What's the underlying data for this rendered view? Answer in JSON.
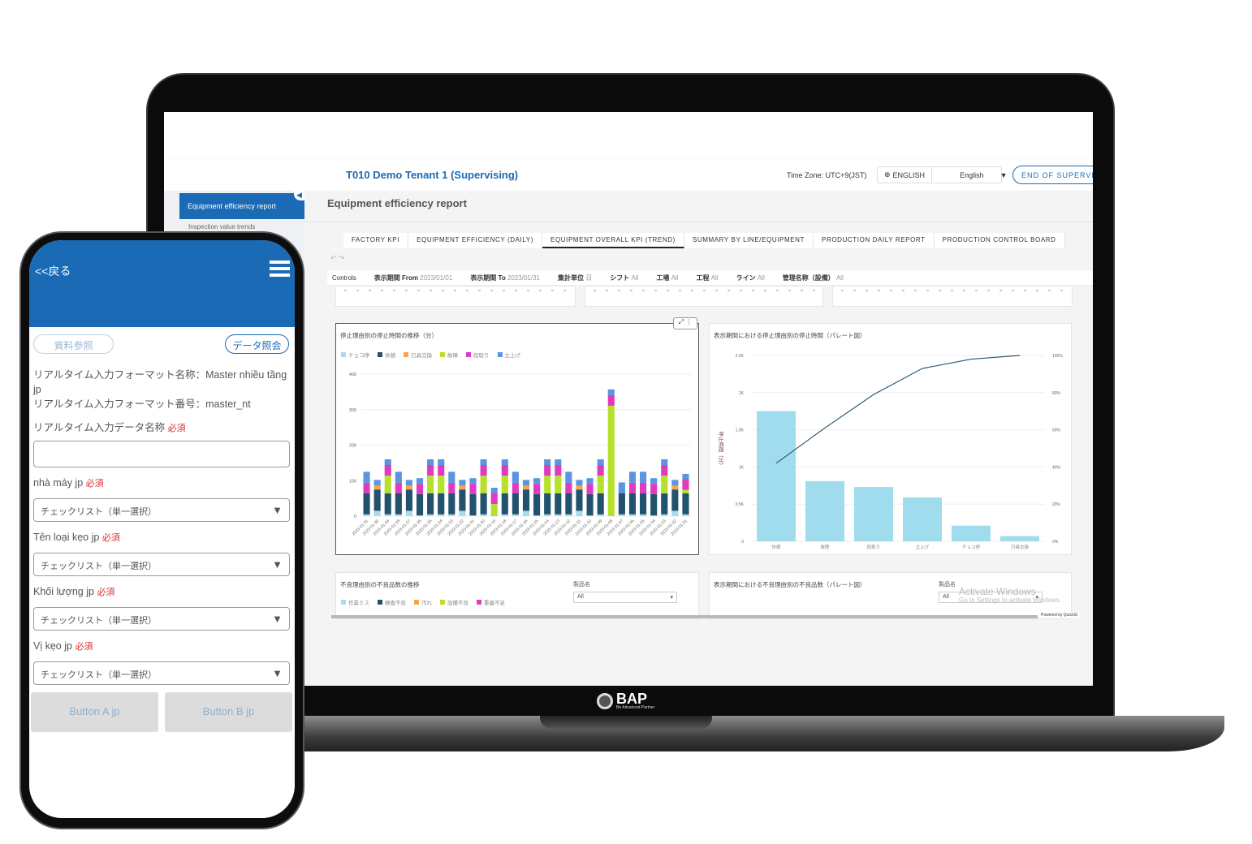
{
  "laptop": {
    "brand": "BAP",
    "brand_tagline": "Be Advanced Partner",
    "header": {
      "tenant": "T010 Demo Tenant 1 (Supervising)",
      "timezone": "Time Zone: UTC+9(JST)",
      "language_icon": "globe-icon",
      "language_label": "ENGLISH",
      "language_select": "English",
      "end_button": "END OF SUPERVI"
    },
    "sidebar": {
      "active_item": "Equipment efficiency report",
      "next_item": "Inspection value trends"
    },
    "page_title": "Equipment efficiency report",
    "tabs": [
      {
        "label": "FACTORY KPI",
        "active": false
      },
      {
        "label": "EQUIPMENT EFFICIENCY (DAILY)",
        "active": false
      },
      {
        "label": "EQUIPMENT OVERALL KPI (TREND)",
        "active": true
      },
      {
        "label": "SUMMARY BY LINE/EQUIPMENT",
        "active": false
      },
      {
        "label": "PRODUCTION DAILY REPORT",
        "active": false
      },
      {
        "label": "PRODUCTION CONTROL BOARD",
        "active": false
      }
    ],
    "controls": {
      "title": "Controls",
      "items": [
        {
          "label": "表示期間 From",
          "value": "2023/01/01"
        },
        {
          "label": "表示期間 To",
          "value": "2023/01/31"
        },
        {
          "label": "集計単位",
          "value": "日"
        },
        {
          "label": "シフト",
          "value": "All"
        },
        {
          "label": "工場",
          "value": "All"
        },
        {
          "label": "工程",
          "value": "All"
        },
        {
          "label": "ライン",
          "value": "All"
        },
        {
          "label": "管理名称（設備）",
          "value": "All"
        }
      ]
    },
    "bottom_left": {
      "title": "不良理由別の不良品数の推移",
      "filter_label": "製品名",
      "filter_value": "All",
      "legend": [
        {
          "name": "作業ミス",
          "color": "#a6dcef"
        },
        {
          "name": "検査不良",
          "color": "#22526e"
        },
        {
          "name": "汚れ",
          "color": "#f5a54a"
        },
        {
          "name": "設備不良",
          "color": "#b5e12c"
        },
        {
          "name": "重量不足",
          "color": "#e03bbf"
        }
      ]
    },
    "bottom_right": {
      "title": "表示期間における不良理由別の不良品数（パレート図）",
      "filter_label": "製品名",
      "filter_value": "All"
    },
    "watermark": {
      "title": "Activate Windows",
      "subtitle": "Go to Settings to activate Windows."
    },
    "powered_by": "Powered by QuickSi"
  },
  "chart_data": [
    {
      "type": "bar",
      "stacked": true,
      "title": "停止理由別の停止時間の推移（分）",
      "ylim": [
        0,
        400
      ],
      "yticks": [
        0,
        100,
        200,
        300,
        400
      ],
      "grid": true,
      "legend_position": "top-left",
      "categories": [
        "2023-01-31",
        "2023-01-30",
        "2023-01-29",
        "2023-01-28",
        "2023-01-27",
        "2023-01-26",
        "2023-01-25",
        "2023-01-24",
        "2023-01-23",
        "2023-01-22",
        "2023-01-21",
        "2023-01-20",
        "2023-01-19",
        "2023-01-18",
        "2023-01-17",
        "2023-01-16",
        "2023-01-15",
        "2023-01-14",
        "2023-01-13",
        "2023-01-12",
        "2023-01-11",
        "2023-01-10",
        "2023-01-09",
        "2023-01-08",
        "2023-01-07",
        "2023-01-06",
        "2023-01-05",
        "2023-01-04",
        "2023-01-03",
        "2023-01-02",
        "2023-01-01"
      ],
      "series": [
        {
          "name": "チョコ停",
          "color": "#a6dcef",
          "values": [
            5,
            15,
            5,
            5,
            15,
            2,
            5,
            5,
            5,
            15,
            2,
            5,
            0,
            5,
            5,
            15,
            2,
            5,
            5,
            5,
            15,
            2,
            5,
            0,
            5,
            5,
            5,
            2,
            5,
            15,
            5
          ]
        },
        {
          "name": "休憩",
          "color": "#22526e",
          "values": [
            59,
            60,
            59,
            59,
            60,
            60,
            59,
            59,
            59,
            60,
            60,
            59,
            0,
            59,
            59,
            60,
            60,
            59,
            59,
            59,
            60,
            60,
            59,
            0,
            59,
            59,
            59,
            60,
            59,
            60,
            59
          ]
        },
        {
          "name": "刃具交換",
          "color": "#f5a54a",
          "values": [
            0,
            11,
            0,
            0,
            11,
            0,
            0,
            0,
            0,
            11,
            0,
            0,
            0,
            0,
            0,
            11,
            0,
            0,
            0,
            0,
            11,
            0,
            0,
            0,
            0,
            0,
            0,
            0,
            0,
            11,
            0
          ]
        },
        {
          "name": "故障",
          "color": "#b5e12c",
          "values": [
            0,
            0,
            50,
            0,
            0,
            0,
            50,
            50,
            0,
            0,
            0,
            50,
            34,
            50,
            0,
            0,
            0,
            50,
            50,
            0,
            0,
            0,
            50,
            311,
            0,
            0,
            0,
            0,
            50,
            0,
            10
          ]
        },
        {
          "name": "段取り",
          "color": "#e03bbf",
          "values": [
            30,
            0,
            30,
            30,
            0,
            29,
            30,
            30,
            30,
            0,
            29,
            30,
            31,
            30,
            30,
            0,
            29,
            30,
            30,
            30,
            0,
            29,
            30,
            30,
            0,
            30,
            30,
            29,
            30,
            0,
            30
          ]
        },
        {
          "name": "立上げ",
          "color": "#5b95e0",
          "values": [
            31,
            16,
            16,
            31,
            16,
            16,
            16,
            16,
            31,
            16,
            16,
            16,
            15,
            16,
            31,
            16,
            16,
            16,
            16,
            31,
            16,
            16,
            16,
            16,
            31,
            31,
            31,
            16,
            16,
            16,
            15
          ]
        }
      ]
    },
    {
      "type": "bar",
      "pareto": true,
      "title": "表示期間における停止理由別の停止時間（パレート図）",
      "ylabel": "停止時間（分）",
      "ylim": [
        0,
        2500
      ],
      "yticks": [
        "0",
        "0.5K",
        "1K",
        "1.5K",
        "2K",
        "2.5K"
      ],
      "y2ticks": [
        "0%",
        "20%",
        "40%",
        "60%",
        "80%",
        "100%"
      ],
      "categories": [
        "休憩",
        "故障",
        "段取り",
        "立上げ",
        "チョコ停",
        "刃具交換"
      ],
      "values": [
        1750,
        810,
        730,
        590,
        210,
        70
      ],
      "cumulative_percent": [
        42,
        61,
        79,
        93,
        98,
        100
      ],
      "bar_color": "#a1dcee",
      "line_color": "#2f5670",
      "grid": true
    }
  ],
  "phone": {
    "back": "<<戻る",
    "menu_icon": "hamburger-menu-icon",
    "ref_button": "資料参照",
    "inquiry_button": "データ照会",
    "format_name": "リアルタイム入力フォーマット名称：Master nhiều tầng jp",
    "format_no": "リアルタイム入力フォーマット番号：master_nt",
    "required": "必須",
    "data_name_label": "リアルタイム入力データ名称",
    "data_name_value": "",
    "fields": [
      {
        "label": "nhà máy jp",
        "value": "チェックリスト（単一選択）"
      },
      {
        "label": "Tên loại kẹo jp",
        "value": "チェックリスト（単一選択）"
      },
      {
        "label": "Khối lượng jp",
        "value": "チェックリスト（単一選択）"
      },
      {
        "label": "Vị kẹo jp",
        "value": "チェックリスト（単一選択）"
      }
    ],
    "button_a": "Button A jp",
    "button_b": "Button B jp",
    "accent": "#1a6ab5"
  }
}
